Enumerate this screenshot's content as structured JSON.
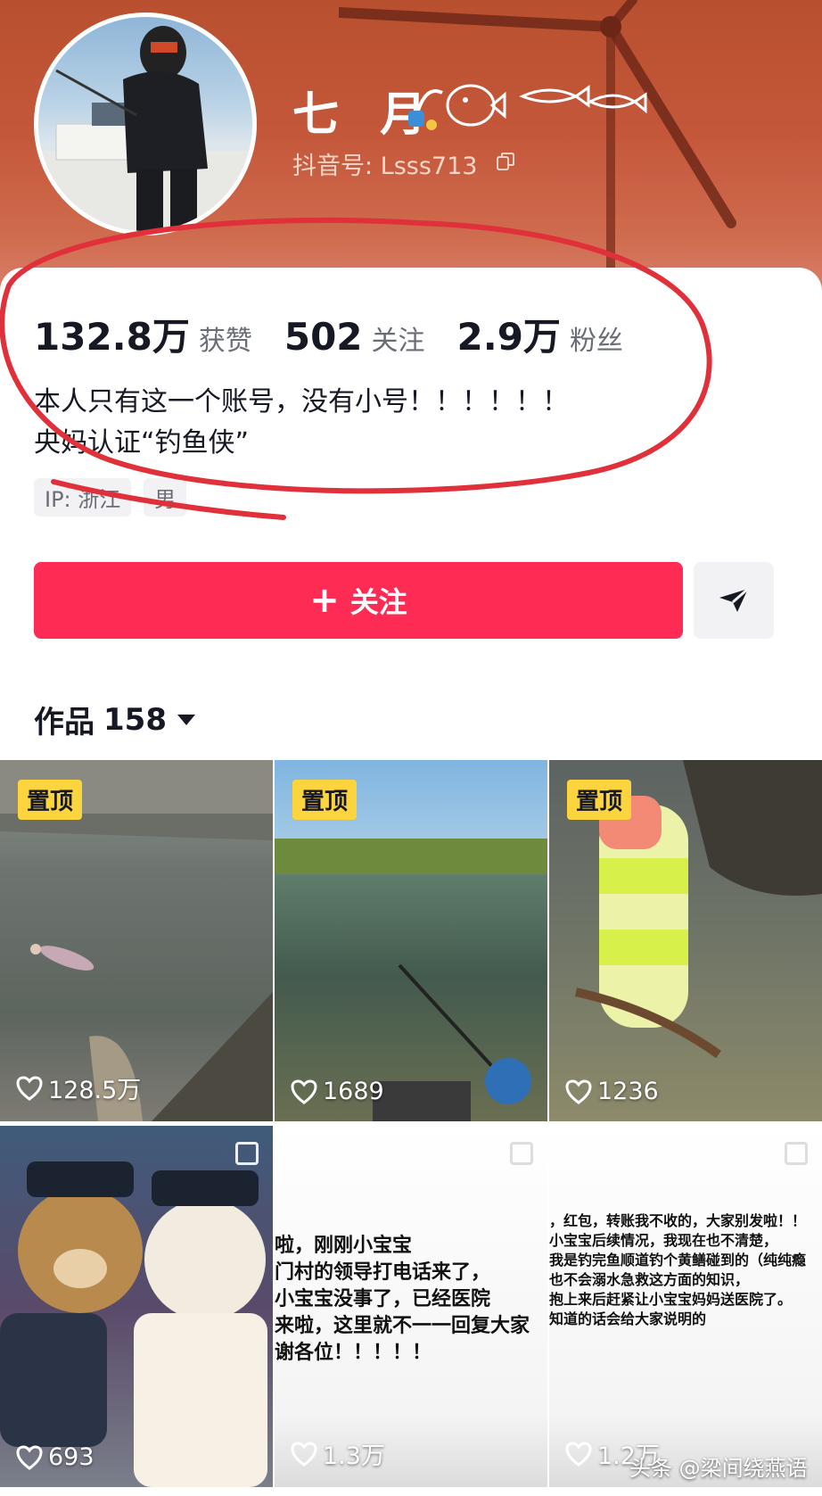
{
  "profile": {
    "display_name": "七 月",
    "douyin_id": "抖音号: Lsss713"
  },
  "stats": [
    {
      "value": "132.8万",
      "label": "获赞"
    },
    {
      "value": "502",
      "label": "关注"
    },
    {
      "value": "2.9万",
      "label": "粉丝"
    }
  ],
  "bio": {
    "line1": "本人只有这一个账号，没有小号！！！！！！",
    "line2": "央妈认证“钓鱼侠”"
  },
  "tags": [
    "IP: 浙江",
    "男"
  ],
  "actions": {
    "follow_plus": "+",
    "follow_label": "关注"
  },
  "works": {
    "label": "作品",
    "count": "158"
  },
  "videos": [
    {
      "pinned_label": "置顶",
      "likes": "128.5万"
    },
    {
      "pinned_label": "置顶",
      "likes": "1689"
    },
    {
      "pinned_label": "置顶",
      "likes": "1236"
    },
    {
      "likes": "693"
    },
    {
      "likes": "1.3万",
      "note_lines": [
        "啦，刚刚小宝宝",
        "门村的领导打电话来了，",
        "小宝宝没事了，已经医院",
        "来啦，这里就不一一回复大家",
        "谢各位！！！！！"
      ]
    },
    {
      "likes": "1.2万",
      "note_lines": [
        "，红包，转账我不收的，大家别发啦！！",
        "小宝宝后续情况，我现在也不清楚，",
        "我是钓完鱼顺道钓个黄鳝碰到的（纯纯瘾",
        "也不会溺水急救这方面的知识，",
        "抱上来后赶紧让小宝宝妈妈送医院了。",
        "知道的话会给大家说明的"
      ]
    }
  ],
  "watermark": "头条 @梁间绕燕语",
  "colors": {
    "accent": "#fe2c55",
    "pin_badge": "#fcd43e",
    "banner": "#c4573a",
    "annotation": "#e0303a"
  }
}
